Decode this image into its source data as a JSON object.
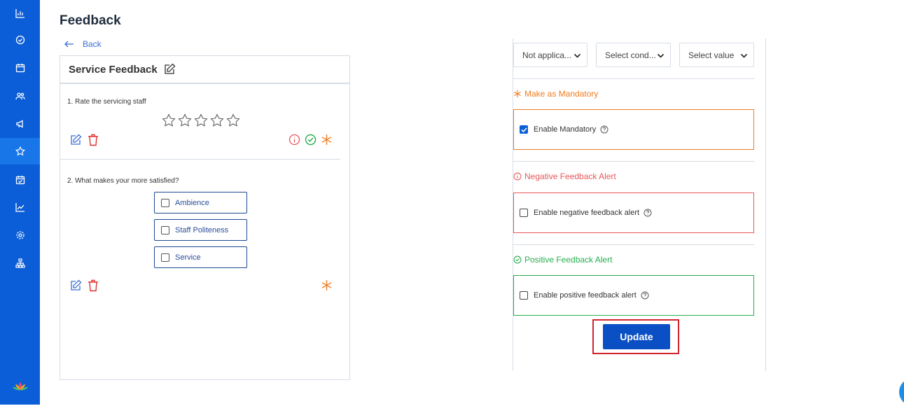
{
  "page": {
    "title": "Feedback",
    "back_label": "Back"
  },
  "form": {
    "title": "Service Feedback",
    "questions": [
      {
        "number_text": "1. Rate the servicing staff",
        "star_count": 5
      },
      {
        "number_text": "2. What makes your more satisfied?",
        "options": [
          "Ambience",
          "Staff Politeness",
          "Service"
        ]
      }
    ]
  },
  "settings": {
    "selects": [
      "Not applica...",
      "Select cond...",
      "Select value"
    ],
    "mandatory": {
      "title": "Make as Mandatory",
      "label": "Enable Mandatory",
      "checked": true,
      "color": "#ef7d22"
    },
    "negative": {
      "title": "Negative Feedback Alert",
      "label": "Enable negative feedback alert",
      "checked": false,
      "color": "#e8585b"
    },
    "positive": {
      "title": "Positive Feedback Alert",
      "label": "Enable positive feedback alert",
      "checked": false,
      "color": "#27ae4f"
    },
    "update_label": "Update"
  },
  "sidebar": {
    "icons": [
      "bar-chart-icon",
      "check-circle-icon",
      "calendar-icon",
      "users-icon",
      "megaphone-icon",
      "star-icon",
      "calendar-check-icon",
      "trend-icon",
      "settings-icon",
      "sitemap-icon"
    ],
    "active": "star-icon"
  },
  "colors": {
    "sidebar": "#0b5ed7",
    "primary": "#0a4fc4",
    "highlight": "#d3232f"
  }
}
